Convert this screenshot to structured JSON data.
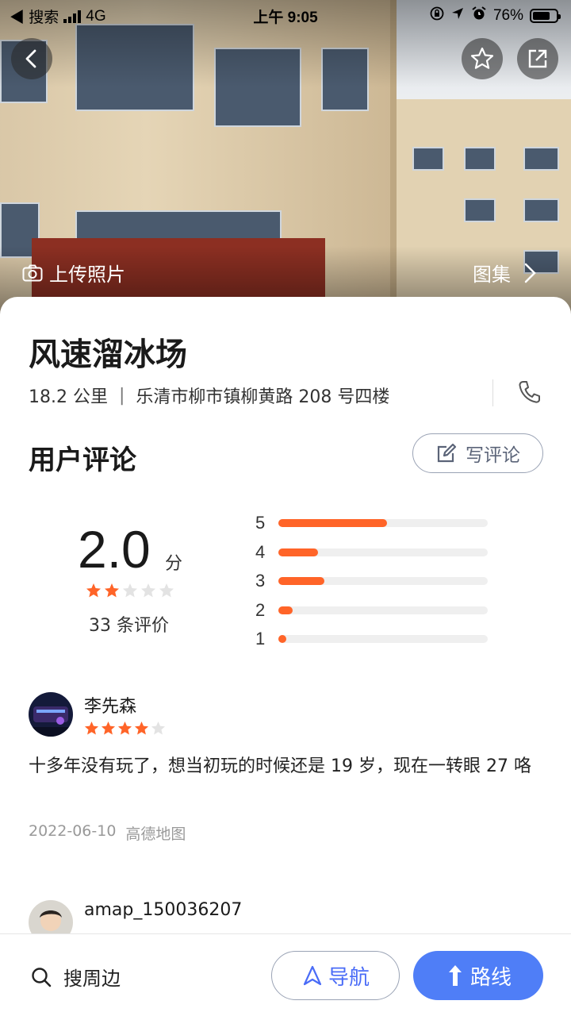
{
  "status_bar": {
    "back_app": "◀ 搜索",
    "network": "4G",
    "time": "上午 9:05",
    "battery": "76%",
    "battery_level": 0.76
  },
  "hero": {
    "upload_label": "上传照片",
    "gallery_label": "图集"
  },
  "place": {
    "name": "风速溜冰场",
    "distance": "18.2 公里",
    "separator": "|",
    "address": "乐清市柳市镇柳黄路 208 号四楼"
  },
  "reviews_section": {
    "title": "用户评论",
    "write_label": "写评论",
    "score": "2.0",
    "score_unit": "分",
    "score_stars": 2,
    "count_text": "33 条评价",
    "distribution": [
      {
        "label": "5",
        "fraction": 0.52
      },
      {
        "label": "4",
        "fraction": 0.19
      },
      {
        "label": "3",
        "fraction": 0.22
      },
      {
        "label": "2",
        "fraction": 0.07
      },
      {
        "label": "1",
        "fraction": 0.02
      }
    ]
  },
  "reviews": [
    {
      "author": "李先森",
      "stars": 4,
      "text": "十多年没有玩了，想当初玩的时候还是 19 岁，现在一转眼 27 咯",
      "date": "2022-06-10",
      "source": "高德地图"
    },
    {
      "author": "amap_150036207"
    }
  ],
  "bottom_bar": {
    "search_label": "搜周边",
    "nav_label": "导航",
    "route_label": "路线"
  },
  "colors": {
    "accent_orange": "#ff6428",
    "primary_blue": "#4f7ef7",
    "star_empty": "#e3e3e3"
  }
}
